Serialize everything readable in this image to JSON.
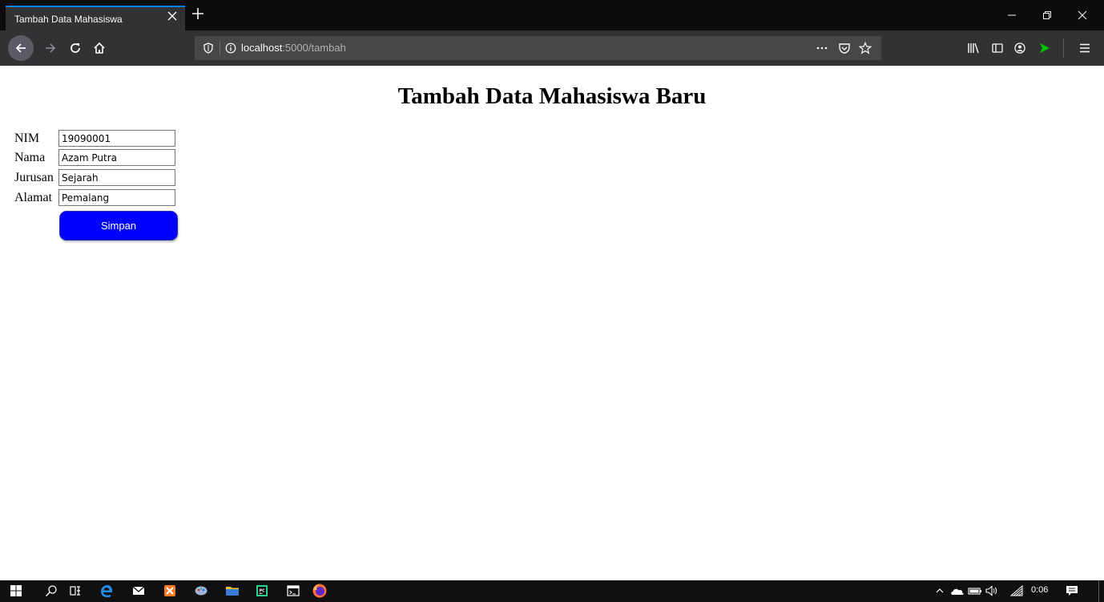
{
  "browser": {
    "tab_title": "Tambah Data Mahasiswa",
    "url_host": "localhost",
    "url_rest": ":5000/tambah",
    "accent_color": "#0a84ff",
    "extension_color": "#00c800"
  },
  "page": {
    "title": "Tambah Data Mahasiswa Baru",
    "fields": [
      {
        "label": "NIM",
        "value": "19090001"
      },
      {
        "label": "Nama",
        "value": "Azam Putra"
      },
      {
        "label": "Jurusan",
        "value": "Sejarah"
      },
      {
        "label": "Alamat",
        "value": "Pemalang"
      }
    ],
    "submit_label": "Simpan",
    "submit_color": "#0000ff"
  },
  "taskbar": {
    "time": "0:06",
    "icons": [
      "windows-start-icon",
      "search-icon",
      "task-view-icon",
      "edge-icon",
      "mail-icon",
      "xampp-icon",
      "paint-icon",
      "file-explorer-icon",
      "pycharm-icon",
      "terminal-icon",
      "firefox-icon"
    ]
  }
}
